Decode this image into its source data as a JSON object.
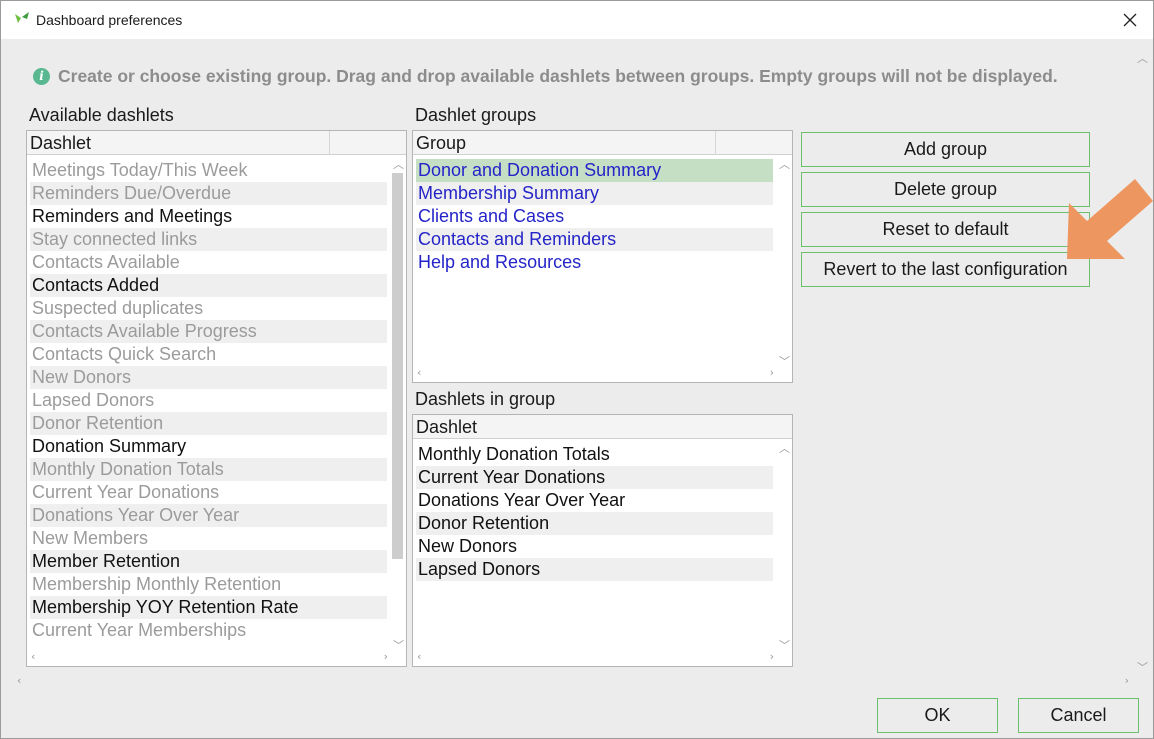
{
  "window": {
    "title": "Dashboard preferences"
  },
  "info": {
    "text": "Create or choose existing group. Drag and drop available dashlets between groups. Empty groups will not be displayed."
  },
  "available": {
    "label": "Available dashlets",
    "column": "Dashlet",
    "items": [
      {
        "text": "Meetings Today/This Week",
        "enabled": false
      },
      {
        "text": "Reminders Due/Overdue",
        "enabled": false
      },
      {
        "text": "Reminders and Meetings",
        "enabled": true
      },
      {
        "text": "Stay connected links",
        "enabled": false
      },
      {
        "text": "Contacts Available",
        "enabled": false
      },
      {
        "text": "Contacts Added",
        "enabled": true
      },
      {
        "text": "Suspected duplicates",
        "enabled": false
      },
      {
        "text": "Contacts Available Progress",
        "enabled": false
      },
      {
        "text": "Contacts Quick Search",
        "enabled": false
      },
      {
        "text": "New Donors",
        "enabled": false
      },
      {
        "text": "Lapsed Donors",
        "enabled": false
      },
      {
        "text": "Donor Retention",
        "enabled": false
      },
      {
        "text": "Donation Summary",
        "enabled": true
      },
      {
        "text": "Monthly Donation Totals",
        "enabled": false
      },
      {
        "text": "Current Year Donations",
        "enabled": false
      },
      {
        "text": "Donations Year Over Year",
        "enabled": false
      },
      {
        "text": "New Members",
        "enabled": false
      },
      {
        "text": "Member Retention",
        "enabled": true
      },
      {
        "text": "Membership Monthly Retention",
        "enabled": false
      },
      {
        "text": "Membership YOY Retention Rate",
        "enabled": true
      },
      {
        "text": "Current Year Memberships",
        "enabled": false
      }
    ]
  },
  "groups": {
    "label": "Dashlet groups",
    "column": "Group",
    "items": [
      {
        "text": "Donor and Donation Summary",
        "selected": true
      },
      {
        "text": "Membership Summary",
        "selected": false
      },
      {
        "text": "Clients and Cases",
        "selected": false
      },
      {
        "text": "Contacts and Reminders",
        "selected": false
      },
      {
        "text": "Help and Resources",
        "selected": false
      }
    ]
  },
  "in_group": {
    "label": "Dashlets in group",
    "column": "Dashlet",
    "items": [
      "Monthly Donation Totals",
      "Current Year Donations",
      "Donations Year Over Year",
      "Donor Retention",
      "New Donors",
      "Lapsed Donors"
    ]
  },
  "buttons": {
    "add_group": "Add group",
    "delete_group": "Delete group",
    "reset_default": "Reset to default",
    "revert_last": "Revert to the last configuration",
    "ok": "OK",
    "cancel": "Cancel"
  },
  "colors": {
    "accent_border": "#6cbf6c",
    "selection": "#c5dfc5",
    "link": "#2424c8",
    "disabled_text": "#9b9b9b",
    "annotation_arrow": "#ee9660",
    "info_icon": "#5ab891"
  },
  "icons": {
    "app": "app-logo-icon",
    "close": "close-icon",
    "info": "info-icon"
  }
}
